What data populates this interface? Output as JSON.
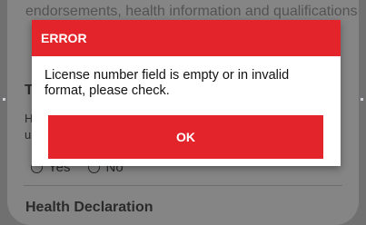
{
  "background": {
    "top_text": "endorsements, health information and qualifications",
    "section_heading_partial": "T",
    "question_line1_partial": "H",
    "question_line2_partial": "u",
    "radio_options": [
      "Yes",
      "No"
    ],
    "health_heading": "Health Declaration"
  },
  "dialog": {
    "title": "ERROR",
    "message": "License number field is empty or in invalid format, please check.",
    "ok_label": "OK"
  },
  "colors": {
    "accent": "#e3242b",
    "overlay": "#858585"
  }
}
